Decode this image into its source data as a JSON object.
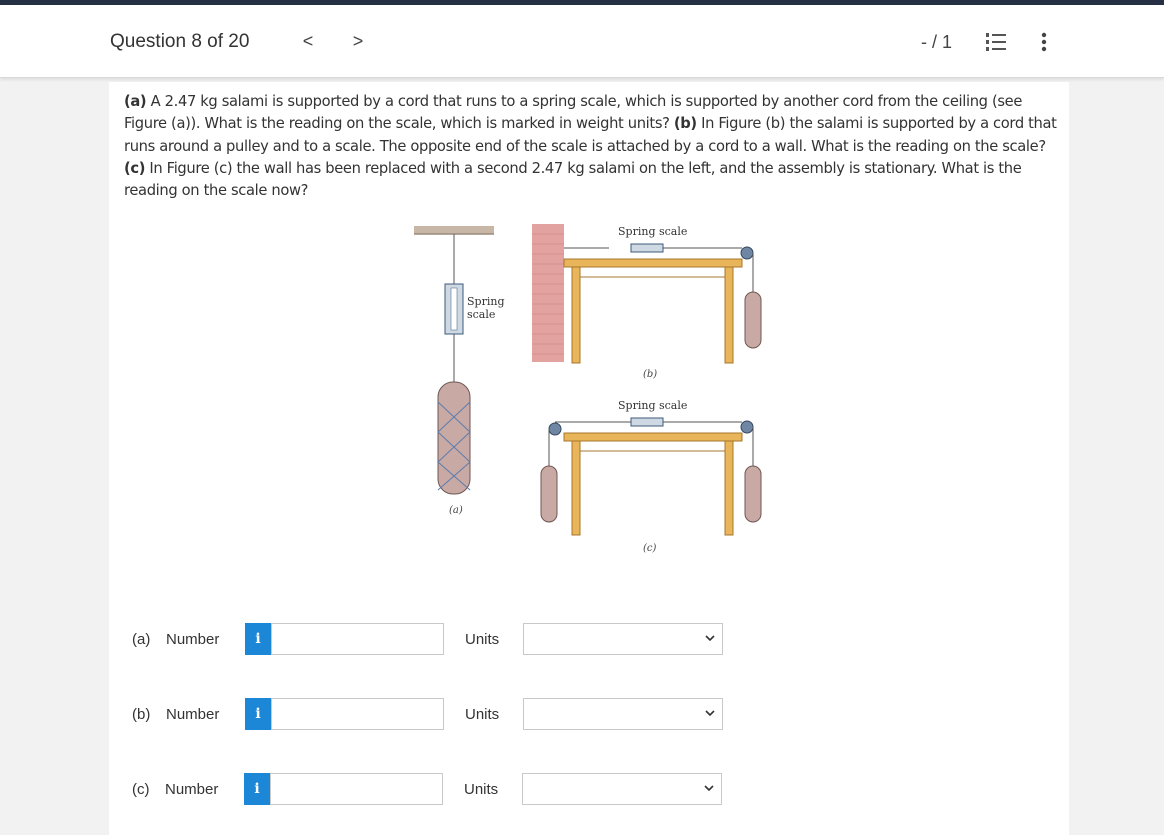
{
  "header": {
    "question_title": "Question 8 of 20",
    "prev_glyph": "<",
    "next_glyph": ">",
    "score": "- / 1",
    "list_icon": "list-icon",
    "more_icon": "more-vertical-icon"
  },
  "prompt": {
    "a_label": "(a)",
    "a_text": " A 2.47 kg salami is supported by a cord that runs to a spring scale, which is supported by another cord from the ceiling (see Figure (a)). What is the reading on the scale, which is marked in weight units? ",
    "b_label": "(b)",
    "b_text": " In Figure (b) the salami is supported by a cord that runs around a pulley and to a scale. The opposite end of the scale is attached by a cord to a wall. What is the reading on the scale? ",
    "c_label": "(c)",
    "c_text": " In Figure (c) the wall has been replaced with a second 2.47 kg salami on the left, and the assembly is stationary. What is the reading on the scale now?"
  },
  "figure": {
    "a_spring_label_1": "Spring",
    "a_spring_label_2": "scale",
    "a_caption": "(a)",
    "b_spring_label": "Spring scale",
    "b_caption": "(b)",
    "c_spring_label": "Spring scale",
    "c_caption": "(c)",
    "colors": {
      "table": "#e9b55a",
      "wall": "#e2a3a0",
      "salami": "#c9a9a3",
      "pulley": "#6f87a5",
      "ceiling": "#c8b6a6"
    }
  },
  "answers": [
    {
      "part": "(a)",
      "number_label": "Number",
      "info": "i",
      "value": "",
      "units_label": "Units",
      "units_selected": ""
    },
    {
      "part": "(b)",
      "number_label": "Number",
      "info": "i",
      "value": "",
      "units_label": "Units",
      "units_selected": ""
    },
    {
      "part": "(c)",
      "number_label": "Number",
      "info": "i",
      "value": "",
      "units_label": "Units",
      "units_selected": ""
    }
  ],
  "colors": {
    "accent_blue": "#1b87d6",
    "top_strip": "#253044"
  }
}
